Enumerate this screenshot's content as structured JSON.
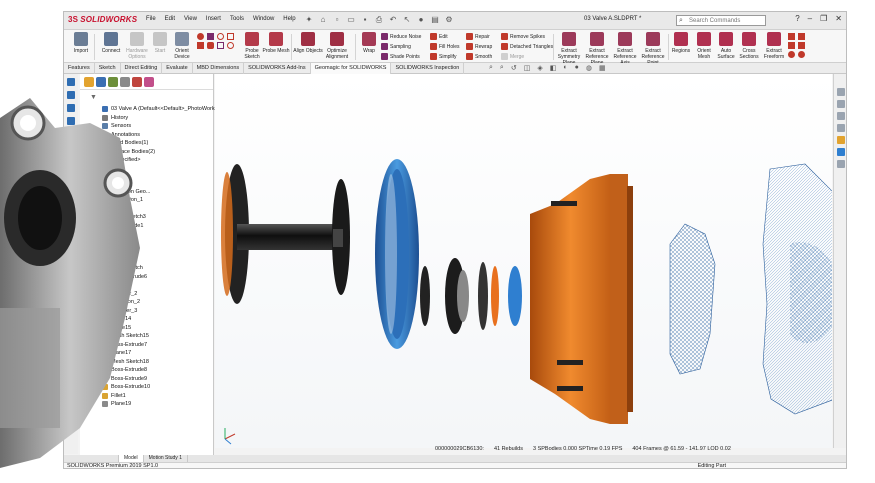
{
  "app": {
    "logo": "SOLIDWORKS",
    "menu": [
      "File",
      "Edit",
      "View",
      "Insert",
      "Tools",
      "Window",
      "Help"
    ],
    "document_title": "03 Valve A.SLDPRT *",
    "search_placeholder": "Search Commands"
  },
  "ribbon": {
    "buttons": [
      {
        "label": "Import",
        "icon": "import-icon"
      },
      {
        "label": "Connect",
        "icon": "connect-icon"
      },
      {
        "label": "Hardware Options",
        "icon": "hardware-icon"
      },
      {
        "label": "Start",
        "icon": "start-icon"
      },
      {
        "label": "Orient Device",
        "icon": "orient-icon"
      },
      {
        "label": "Probe Sketch",
        "icon": "probe-sketch-icon"
      },
      {
        "label": "Probe Mesh",
        "icon": "probe-mesh-icon"
      },
      {
        "label": "Align Objects",
        "icon": "align-icon"
      },
      {
        "label": "Optimize Alignment",
        "icon": "optimize-icon"
      },
      {
        "label": "Wrap",
        "icon": "wrap-icon"
      }
    ],
    "small_left": [
      "Reduce Noise",
      "Sampling",
      "Shade Points"
    ],
    "small_mid": [
      "Edit",
      "Fill Holes",
      "Simplify"
    ],
    "small_mid2": [
      "Repair",
      "Rewrap",
      "Smooth"
    ],
    "small_right": [
      "Remove Spikes",
      "Detached Triangles",
      "Merge"
    ],
    "buttons2": [
      {
        "label": "Extract Symmetry Plane",
        "icon": "symmetry-icon"
      },
      {
        "label": "Extract Reference Plane",
        "icon": "ref-plane-icon"
      },
      {
        "label": "Extract Reference Axis",
        "icon": "ref-axis-icon"
      },
      {
        "label": "Extract Reference Point",
        "icon": "ref-point-icon"
      },
      {
        "label": "Regions",
        "icon": "regions-icon"
      },
      {
        "label": "Orient Mesh",
        "icon": "orient-mesh-icon"
      },
      {
        "label": "Auto Surface",
        "icon": "auto-surface-icon"
      },
      {
        "label": "Cross Sections",
        "icon": "cross-section-icon"
      },
      {
        "label": "Extract Freeform",
        "icon": "freeform-icon"
      },
      {
        "label": "Deviation Analysis",
        "icon": "deviation-icon"
      },
      {
        "label": "Show",
        "icon": "show-icon"
      },
      {
        "label": "Settings",
        "icon": "settings-icon"
      }
    ]
  },
  "tabs": [
    "Features",
    "Sketch",
    "Direct Editing",
    "Evaluate",
    "MBD Dimensions",
    "SOLIDWORKS Add-Ins",
    "Geomagic for SOLIDWORKS",
    "SOLIDWORKS Inspection"
  ],
  "active_tab": "Geomagic for SOLIDWORKS",
  "tree": [
    {
      "label": "03 Valve A  (Default<<Default>_PhotoWorks...",
      "icon": "part-icon"
    },
    {
      "label": "History",
      "icon": "history-icon"
    },
    {
      "label": "Sensors",
      "icon": "sensor-icon"
    },
    {
      "label": "Annotations",
      "icon": "annotation-icon"
    },
    {
      "label": "Solid Bodies(1)",
      "icon": "solid-bodies-icon"
    },
    {
      "label": "Surface Bodies(2)",
      "icon": "surface-bodies-icon"
    },
    {
      "label": "...specified>",
      "icon": "material-icon"
    },
    {
      "label": "Top",
      "icon": "plane-icon"
    },
    {
      "label": "Right",
      "icon": "plane-icon"
    },
    {
      "label": "",
      "icon": "origin-icon"
    },
    {
      "label": "Extrusion Geo...",
      "icon": "feature-icon"
    },
    {
      "label": "Revolution_1",
      "icon": "feature-icon"
    },
    {
      "label": "Plane5",
      "icon": "plane-icon"
    },
    {
      "label": "Mesh Sketch3",
      "icon": "sketch-icon"
    },
    {
      "label": "Cut-Extrude1",
      "icon": "feature-icon"
    },
    {
      "label": "Cylinder_1",
      "icon": "feature-icon"
    },
    {
      "label": "Plane6",
      "icon": "plane-icon"
    },
    {
      "label": "Plane9",
      "icon": "plane-icon"
    },
    {
      "label": "Plane8",
      "icon": "plane-icon"
    },
    {
      "label": "Mesh Sketch",
      "icon": "sketch-icon"
    },
    {
      "label": "Boss-Extrude6",
      "icon": "feature-icon"
    },
    {
      "label": "Plane10",
      "icon": "plane-icon"
    },
    {
      "label": "Cylinder_2",
      "icon": "feature-icon"
    },
    {
      "label": "Extrusion_2",
      "icon": "feature-icon"
    },
    {
      "label": "Cylinder_3",
      "icon": "feature-icon"
    },
    {
      "label": "Plane14",
      "icon": "plane-icon"
    },
    {
      "label": "Plane15",
      "icon": "plane-icon"
    },
    {
      "label": "Mesh Sketch15",
      "icon": "sketch-icon"
    },
    {
      "label": "Boss-Extrude7",
      "icon": "feature-icon"
    },
    {
      "label": "Plane17",
      "icon": "plane-icon"
    },
    {
      "label": "Mesh Sketch18",
      "icon": "sketch-icon"
    },
    {
      "label": "Boss-Extrude8",
      "icon": "feature-icon"
    },
    {
      "label": "Boss-Extrude9",
      "icon": "feature-icon"
    },
    {
      "label": "Boss-Extrude10",
      "icon": "feature-icon"
    },
    {
      "label": "Fillet1",
      "icon": "fillet-icon"
    },
    {
      "label": "Plane19",
      "icon": "plane-icon"
    }
  ],
  "status_overlay": [
    "000000029CB6130:",
    "41 Rebuilds",
    "3 SPBodies  0.000 SPTime  0.19 FPS",
    "404 Frames @  61.59 - 141.97 LOD 0.02"
  ],
  "bottom_tabs": [
    "Model",
    "Motion Study 1"
  ],
  "status_left": "SOLIDWORKS Premium 2019 SP1.0",
  "status_right": "Editing Part",
  "colors": {
    "accent_orange": "#e8701e",
    "accent_blue": "#2f7fd0",
    "brand_red": "#c8102e"
  }
}
